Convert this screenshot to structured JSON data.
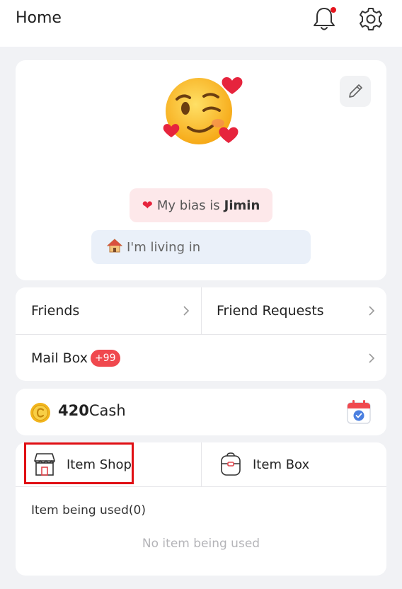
{
  "header": {
    "title": "Home",
    "icons": [
      "bell-icon",
      "gear-icon"
    ],
    "notification_dot_color": "#e5141d"
  },
  "profile": {
    "avatar_icon": "smiling-face-with-hearts-emoji",
    "edit_icon": "pencil-icon",
    "bias": {
      "prefix": "My bias is",
      "name": "Jimin",
      "icon": "red-heart-emoji",
      "bg_color": "#fde8ea"
    },
    "living": {
      "text": "I'm living in",
      "icon": "house-emoji",
      "bg_color": "#eaf0f9"
    }
  },
  "menu": {
    "friends_label": "Friends",
    "friend_requests_label": "Friend Requests",
    "mailbox_label": "Mail Box",
    "mailbox_badge": "+99",
    "badge_color": "#f0484e",
    "chevron_icon": "chevron-right-icon"
  },
  "cash": {
    "amount": "420",
    "unit": "Cash",
    "coin_icon": "coin-icon",
    "calendar_icon": "calendar-check-icon"
  },
  "items": {
    "tab_shop_label": "Item Shop",
    "tab_box_label": "Item Box",
    "shop_icon": "store-icon",
    "box_icon": "backpack-icon",
    "being_used_title": "Item being used(0)",
    "empty_message": "No item being used",
    "highlight_color": "#e00f14"
  }
}
